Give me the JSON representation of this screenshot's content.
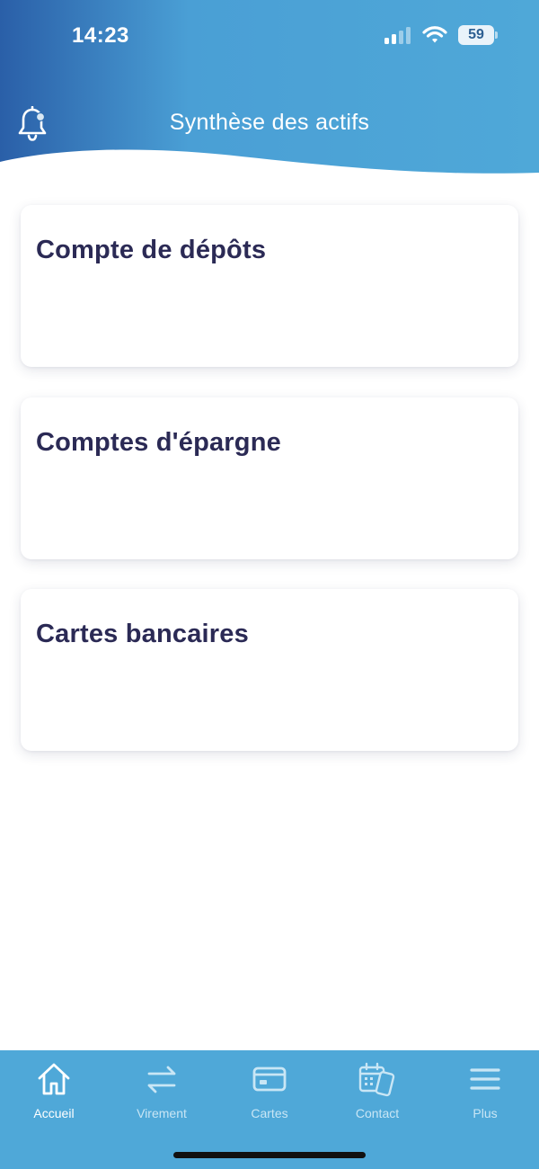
{
  "status_bar": {
    "time": "14:23",
    "battery": "59",
    "signal_icon": "cellular-signal-icon",
    "wifi_icon": "wifi-icon"
  },
  "header": {
    "title": "Synthèse des actifs",
    "bell_icon": "notification-bell-icon"
  },
  "cards": [
    {
      "title": "Compte de dépôts"
    },
    {
      "title": "Comptes d'épargne"
    },
    {
      "title": "Cartes bancaires"
    }
  ],
  "bottom_nav": {
    "items": [
      {
        "label": "Accueil",
        "icon": "home-icon",
        "active": true
      },
      {
        "label": "Virement",
        "icon": "transfer-arrows-icon",
        "active": false
      },
      {
        "label": "Cartes",
        "icon": "card-icon",
        "active": false
      },
      {
        "label": "Contact",
        "icon": "calendar-phone-icon",
        "active": false
      },
      {
        "label": "Plus",
        "icon": "menu-icon",
        "active": false
      }
    ]
  },
  "colors": {
    "header_dark": "#2a5fa8",
    "header_light": "#4fa8d8",
    "title_text": "#2b2a55",
    "nav_background": "#4fa8d8"
  }
}
